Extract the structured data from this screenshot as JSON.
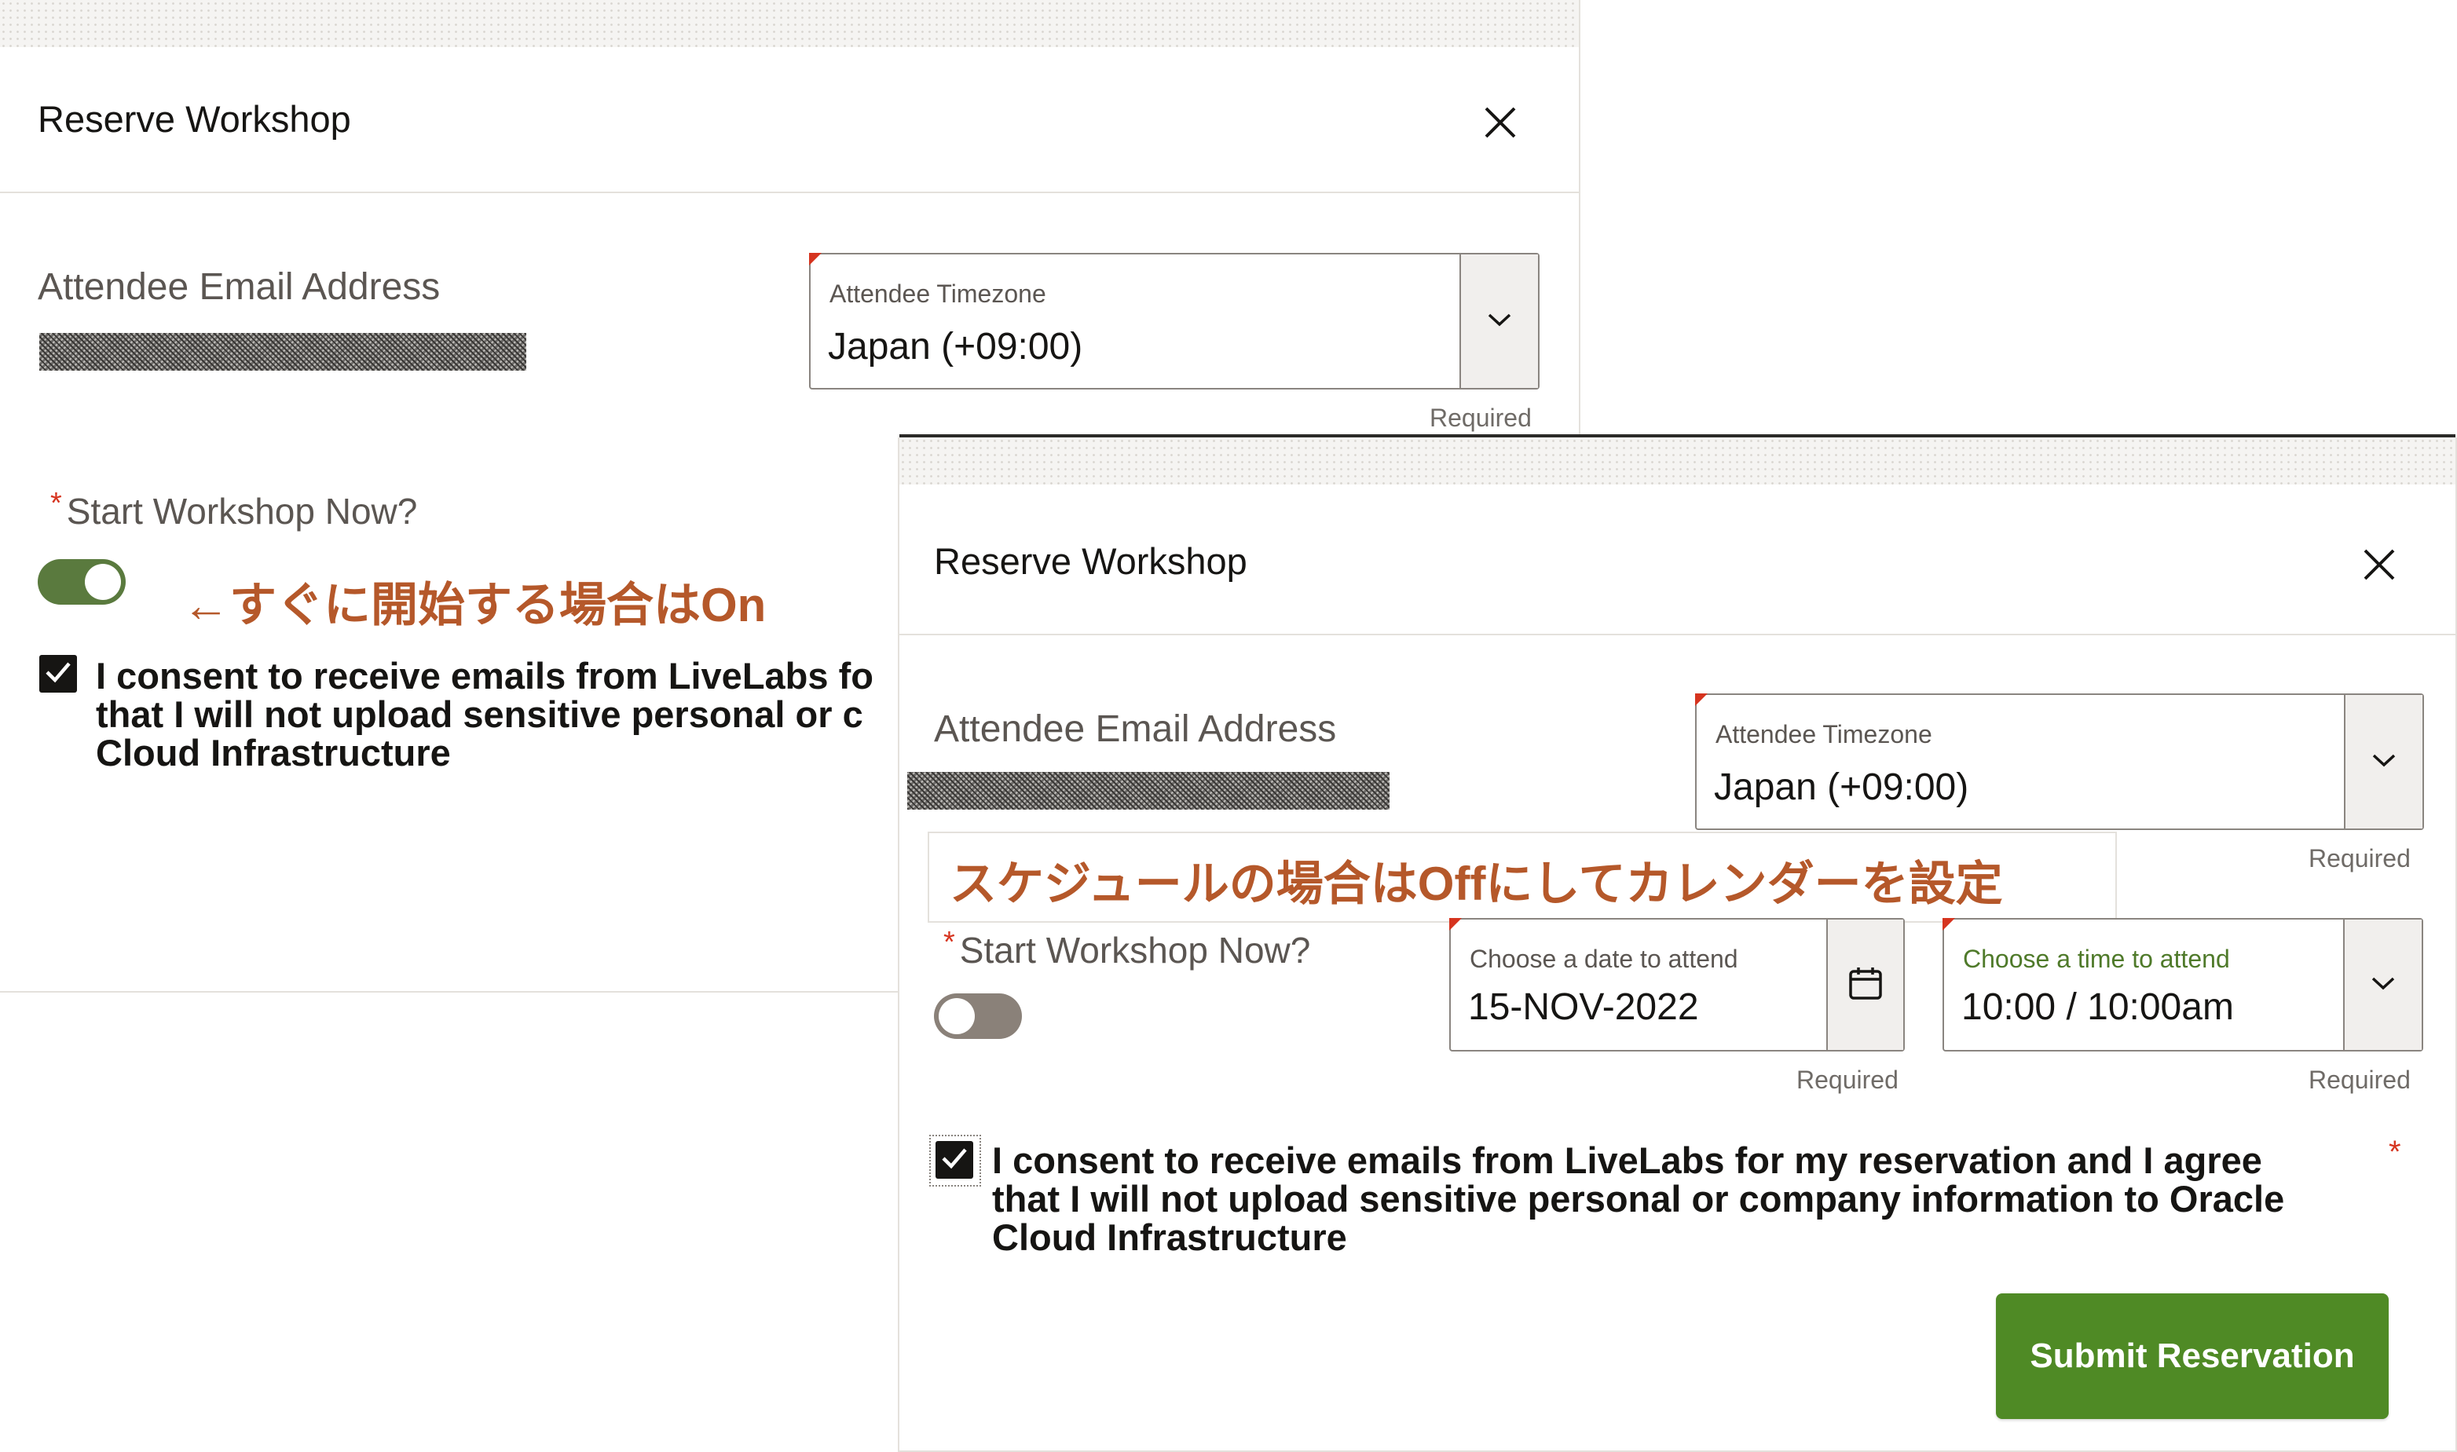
{
  "panel1": {
    "title": "Reserve Workshop",
    "email_label": "Attendee Email Address",
    "timezone": {
      "label": "Attendee Timezone",
      "value": "Japan (+09:00)",
      "required": "Required"
    },
    "start_label": "Start Workshop Now?",
    "start_required_mark": "*",
    "toggle_state": "on",
    "consent_checked": true,
    "consent_lines": [
      "I consent to receive emails from LiveLabs fo",
      "that I will not upload sensitive personal or c",
      "Cloud Infrastructure"
    ]
  },
  "panel2": {
    "title": "Reserve Workshop",
    "email_label": "Attendee Email Address",
    "timezone": {
      "label": "Attendee Timezone",
      "value": "Japan (+09:00)",
      "required": "Required"
    },
    "start_label": "Start Workshop Now?",
    "start_required_mark": "*",
    "toggle_state": "off",
    "date_field": {
      "label": "Choose a date to attend",
      "value": "15-NOV-2022",
      "required": "Required"
    },
    "time_field": {
      "label": "Choose a time to attend",
      "value": "10:00 / 10:00am",
      "required": "Required"
    },
    "consent_checked": true,
    "consent_lines": [
      "I consent to receive emails from LiveLabs for my reservation and I agree",
      "that I will not upload sensitive personal or company information to Oracle",
      "Cloud Infrastructure"
    ],
    "consent_required_mark": "*",
    "submit_label": "Submit Reservation"
  },
  "annotations": {
    "toggle_on_note": "←すぐに開始する場合はOn",
    "schedule_note": "スケジュールの場合はOffにしてカレンダーを設定"
  },
  "colors": {
    "accent_green": "#4f8a25",
    "toggle_on": "#5a7a3e",
    "toggle_off": "#8a8179",
    "required_red": "#d6341f",
    "annotation_orange": "#b5582a"
  },
  "icons": [
    "close-icon",
    "chevron-down-icon",
    "calendar-icon",
    "checkmark-icon"
  ]
}
